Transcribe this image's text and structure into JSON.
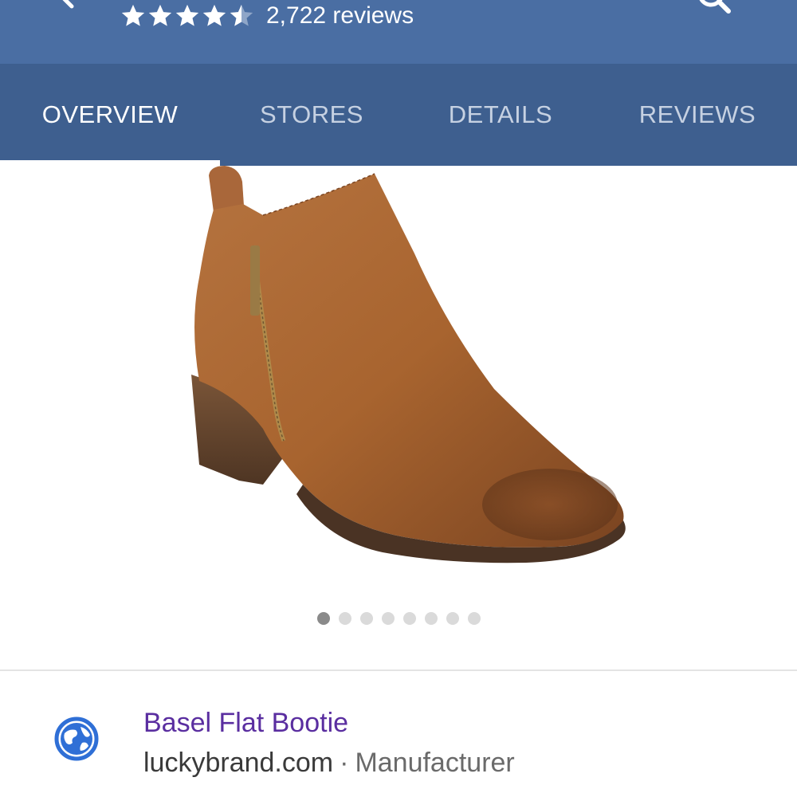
{
  "header": {
    "rating": {
      "stars_filled": 4.5,
      "stars_total": 5,
      "review_count": "2,722 reviews"
    },
    "icons": [
      "back-arrow-icon",
      "search-icon"
    ]
  },
  "tabs": [
    {
      "label": "OVERVIEW",
      "active": true
    },
    {
      "label": "STORES",
      "active": false
    },
    {
      "label": "DETAILS",
      "active": false
    },
    {
      "label": "REVIEWS",
      "active": false
    }
  ],
  "carousel": {
    "dot_count": 8,
    "active_index": 0
  },
  "result": {
    "title": "Basel Flat Bootie",
    "domain": "luckybrand.com",
    "separator": "·",
    "source_type": "Manufacturer",
    "icon": "globe-icon"
  },
  "colors": {
    "header_bg": "#4a6ea3",
    "tab_bg": "#3e5f8f",
    "link": "#5a2ea0",
    "globe": "#2f6fd6"
  }
}
